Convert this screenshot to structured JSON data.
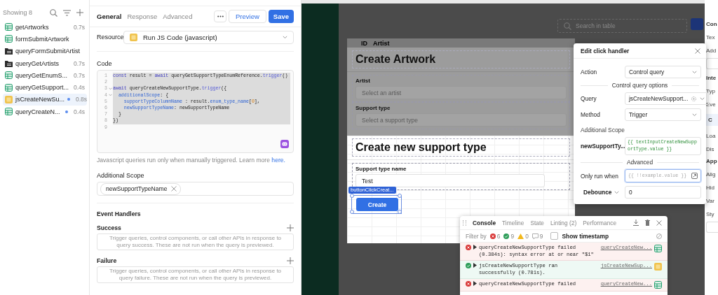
{
  "sidebar": {
    "count_label": "Showing 8",
    "items": [
      {
        "name": "getArtworks",
        "kind": "table",
        "time": "0.7s",
        "unsaved": false,
        "selected": false
      },
      {
        "name": "formSubmitArtwork",
        "kind": "table",
        "unsaved": false,
        "selected": false
      },
      {
        "name": "queryFormSubmitArtist",
        "kind": "query",
        "unsaved": false,
        "selected": false
      },
      {
        "name": "queryGetArtists",
        "kind": "query",
        "time": "0.7s",
        "unsaved": false,
        "selected": false
      },
      {
        "name": "queryGetEnumS...",
        "kind": "table",
        "time": "0.7s",
        "unsaved": false,
        "selected": false
      },
      {
        "name": "queryGetSupport...",
        "kind": "table",
        "time": "0.4s",
        "unsaved": false,
        "selected": false
      },
      {
        "name": "jsCreateNewSu...",
        "kind": "js",
        "time": "0.8s",
        "unsaved": true,
        "selected": true
      },
      {
        "name": "queryCreateN...",
        "kind": "table",
        "time": "0.4s",
        "unsaved": true,
        "selected": false
      }
    ]
  },
  "query_editor": {
    "tabs": [
      {
        "label": "General",
        "selected": true
      },
      {
        "label": "Response",
        "selected": false
      },
      {
        "label": "Advanced",
        "selected": false
      }
    ],
    "preview_button": "Preview",
    "save_button": "Save",
    "resource": {
      "label": "Resource",
      "value": "Run JS Code (javascript)"
    },
    "code": {
      "label": "Code",
      "lines": [
        {
          "number": "1",
          "selected": true,
          "foldable": false,
          "tokens": [
            {
              "text": "const",
              "kind": "kw"
            },
            {
              "text": " result = ",
              "kind": "plain"
            },
            {
              "text": "await",
              "kind": "kw"
            },
            {
              "text": " queryGetSupportTypeEnumReference.",
              "kind": "plain"
            },
            {
              "text": "trigger",
              "kind": "fn"
            },
            {
              "text": "()",
              "kind": "plain"
            }
          ]
        },
        {
          "number": "2",
          "selected": true,
          "foldable": false
        },
        {
          "number": "3",
          "selected": true,
          "foldable": true,
          "tokens": [
            {
              "text": "await",
              "kind": "kw"
            },
            {
              "text": " queryCreateNewSupportType.",
              "kind": "plain"
            },
            {
              "text": "trigger",
              "kind": "fn"
            },
            {
              "text": "({",
              "kind": "plain"
            }
          ]
        },
        {
          "number": "4",
          "selected": true,
          "foldable": true,
          "tokens": [
            {
              "text": "  additionalScope",
              "kind": "prop"
            },
            {
              "text": ": {",
              "kind": "plain"
            }
          ]
        },
        {
          "number": "5",
          "selected": true,
          "foldable": false,
          "tokens": [
            {
              "text": "    supportTypeColumnName",
              "kind": "prop"
            },
            {
              "text": " : result.",
              "kind": "plain"
            },
            {
              "text": "enum_type_name",
              "kind": "prop"
            },
            {
              "text": "[",
              "kind": "plain"
            },
            {
              "text": "0",
              "kind": "num"
            },
            {
              "text": "],",
              "kind": "plain"
            }
          ]
        },
        {
          "number": "6",
          "selected": true,
          "foldable": false,
          "tokens": [
            {
              "text": "    newSupportTypeName",
              "kind": "prop"
            },
            {
              "text": ": newSupportTypeName",
              "kind": "plain"
            }
          ]
        },
        {
          "number": "7",
          "selected": true,
          "foldable": false,
          "tokens": [
            {
              "text": "  }",
              "kind": "plain"
            }
          ]
        },
        {
          "number": "8",
          "selected": true,
          "foldable": false,
          "tokens": [
            {
              "text": "})",
              "kind": "plain"
            }
          ]
        },
        {
          "number": "9",
          "selected": false,
          "foldable": false
        }
      ]
    },
    "note": {
      "text": "Javascript queries run only when manually triggered. Learn more",
      "link": "here."
    },
    "additional_scope": {
      "label": "Additional Scope",
      "tags": [
        "newSupportTypeName"
      ]
    },
    "event_handlers": {
      "title": "Event Handlers",
      "sections": [
        {
          "label": "Success",
          "hint": "Trigger queries, control components, or call other APIs in response to query success. These are not run when the query is previewed."
        },
        {
          "label": "Failure",
          "hint": "Trigger queries, control components, or call other APIs in response to query failure. These are not run when the query is previewed."
        }
      ]
    }
  },
  "canvas": {
    "search": {
      "placeholder": "Search in table"
    },
    "table_columns": [
      "ID",
      "Artist"
    ],
    "modals": [
      {
        "title": "Create Artwork",
        "dimmed": true,
        "fields": [
          {
            "kind": "select",
            "label": "Artist",
            "placeholder": "Select an artist"
          },
          {
            "kind": "select",
            "label": "Support type",
            "placeholder": "Select a support type"
          }
        ]
      },
      {
        "title": "Create new support type",
        "dimmed": false,
        "fields": [
          {
            "kind": "text",
            "label": "Support type name",
            "value": "Test"
          }
        ],
        "button": {
          "label": "Create",
          "tag": "buttonClickCreat...",
          "selected": true
        }
      }
    ]
  },
  "click_handler": {
    "title": "Edit click handler",
    "items": [
      {
        "kind": "select",
        "label": "Action",
        "value": "Control query",
        "target": false
      },
      {
        "kind": "section",
        "label": "Control query options"
      },
      {
        "kind": "select",
        "label": "Query",
        "value": "jsCreateNewSupport...",
        "target": true
      },
      {
        "kind": "select",
        "label": "Method",
        "value": "Trigger",
        "target": false
      },
      {
        "kind": "heading",
        "label": "Additional Scope"
      },
      {
        "kind": "code",
        "label": "newSupportTy...",
        "value": "{{ textInputCreateNewSupportType.value }}"
      },
      {
        "kind": "section",
        "label": "Advanced"
      },
      {
        "kind": "code-input",
        "label": "Only run when",
        "placeholder": "{{ !!example.value }}",
        "focused": true
      },
      {
        "kind": "input",
        "label": "Debounce",
        "value": "0",
        "dropdown": true
      }
    ]
  },
  "console": {
    "tabs": [
      {
        "label": "Console",
        "selected": true
      },
      {
        "label": "Timeline",
        "selected": false
      },
      {
        "label": "State",
        "selected": false
      },
      {
        "label": "Linting (2)",
        "selected": false
      },
      {
        "label": "Performance",
        "selected": false
      }
    ],
    "filter_label": "Filter by",
    "filters": [
      {
        "kind": "error",
        "count": "6"
      },
      {
        "kind": "success",
        "count": "9"
      },
      {
        "kind": "warning",
        "count": "0"
      },
      {
        "kind": "info",
        "count": "9"
      }
    ],
    "timestamp": {
      "label": "Show timestamp",
      "checked": false
    },
    "entries": [
      {
        "kind": "error",
        "message": "queryCreateNewSupportType failed (0.384s): syntax error at or near \"$1\"",
        "source": {
          "text": "queryCreateNew...",
          "kind": "table"
        }
      },
      {
        "kind": "success",
        "message": "jsCreateNewSupportType ran successfully (0.781s).",
        "source": {
          "text": "jsCreateNewSup...",
          "kind": "js"
        }
      },
      {
        "kind": "error",
        "message": "queryCreateNewSupportType failed",
        "source": {
          "text": "queryCreateNew...",
          "kind": "table"
        }
      }
    ]
  },
  "inspector": {
    "labels": [
      {
        "kind": "heading",
        "text": "Con"
      },
      {
        "kind": "label",
        "text": "Tex"
      },
      {
        "kind": "label",
        "text": "Add"
      },
      {
        "kind": "field"
      },
      {
        "kind": "heading",
        "text": "Inte"
      },
      {
        "kind": "label",
        "text": "Typ"
      },
      {
        "kind": "label",
        "text": "Eve"
      },
      {
        "kind": "item",
        "text": "C"
      },
      {
        "kind": "label",
        "text": "Loa"
      },
      {
        "kind": "label",
        "text": "Dis"
      },
      {
        "kind": "heading",
        "text": "App"
      },
      {
        "kind": "label",
        "text": "Alig"
      },
      {
        "kind": "label",
        "text": "Hid"
      },
      {
        "kind": "label",
        "text": "Var"
      },
      {
        "kind": "label",
        "text": "Sty"
      },
      {
        "kind": "field"
      }
    ]
  }
}
